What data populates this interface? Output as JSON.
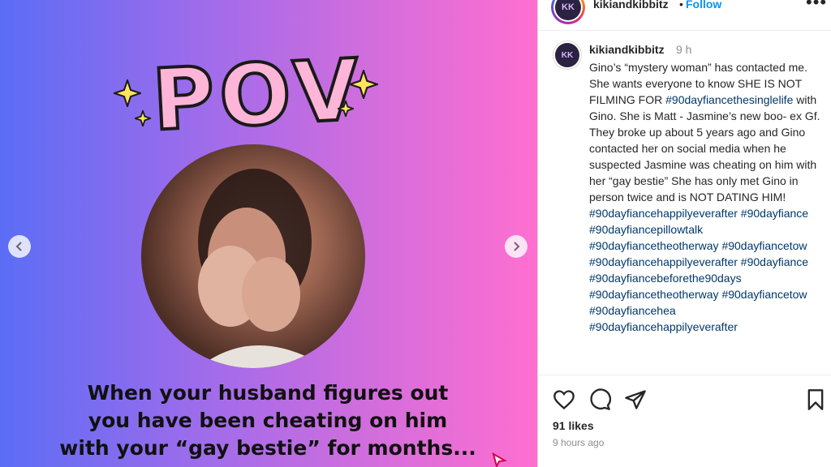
{
  "post": {
    "pov_text": "POV",
    "caption_lines": [
      "When your husband figures out",
      "you have been cheating on him",
      "with your “gay bestie” for months..."
    ],
    "prev_icon": "chevron-left-icon",
    "next_icon": "chevron-right-icon"
  },
  "header": {
    "avatar_text": "KK",
    "username": "kikiandkibbitz",
    "separator": "•",
    "follow_label": "Follow",
    "more_label": "•••"
  },
  "comment": {
    "avatar_text": "KK",
    "username": "kikiandkibbitz",
    "time": "9 h",
    "segments": [
      {
        "type": "text",
        "value": "Gino’s “mystery woman” has contacted me. She wants everyone to know SHE IS NOT FILMING FOR "
      },
      {
        "type": "tag",
        "value": "#90dayfiancethesinglelife"
      },
      {
        "type": "text",
        "value": " with Gino. She is Matt - Jasmine’s new boo- ex Gf. They broke up about 5 years ago and Gino contacted her on social media when he suspected Jasmine was cheating on him with her “gay bestie” She has only met Gino in person twice and is NOT DATING HIM! "
      },
      {
        "type": "tag",
        "value": "#90dayfiancehappilyeverafter"
      },
      {
        "type": "text",
        "value": " "
      },
      {
        "type": "tag",
        "value": "#90dayfiance"
      },
      {
        "type": "text",
        "value": " "
      },
      {
        "type": "tag",
        "value": "#90dayfiancepillowtalk"
      },
      {
        "type": "text",
        "value": " "
      },
      {
        "type": "tag",
        "value": "#90dayfiancetheotherway"
      },
      {
        "type": "text",
        "value": " "
      },
      {
        "type": "tag",
        "value": "#90dayfiancetow"
      },
      {
        "type": "text",
        "value": " "
      },
      {
        "type": "tag",
        "value": "#90dayfiancehappilyeverafter"
      },
      {
        "type": "text",
        "value": " "
      },
      {
        "type": "tag",
        "value": "#90dayfiance"
      },
      {
        "type": "text",
        "value": " "
      },
      {
        "type": "tag",
        "value": "#90dayfiancebeforethe90days"
      },
      {
        "type": "text",
        "value": " "
      },
      {
        "type": "tag",
        "value": "#90dayfiancetheotherway"
      },
      {
        "type": "text",
        "value": " "
      },
      {
        "type": "tag",
        "value": "#90dayfiancetow"
      },
      {
        "type": "text",
        "value": " "
      },
      {
        "type": "tag",
        "value": "#90dayfiancehea"
      },
      {
        "type": "text",
        "value": " "
      },
      {
        "type": "tag",
        "value": "#90dayfiancehappilyeverafter"
      }
    ]
  },
  "actions": {
    "like_icon": "heart-icon",
    "comment_icon": "comment-icon",
    "share_icon": "share-icon",
    "save_icon": "bookmark-icon",
    "likes": "91 likes",
    "time_ago": "9 hours ago"
  },
  "colors": {
    "link": "#00376b",
    "follow": "#0095f6",
    "pov_fill": "#ffb5d8",
    "sparkle": "#ffe45c"
  }
}
